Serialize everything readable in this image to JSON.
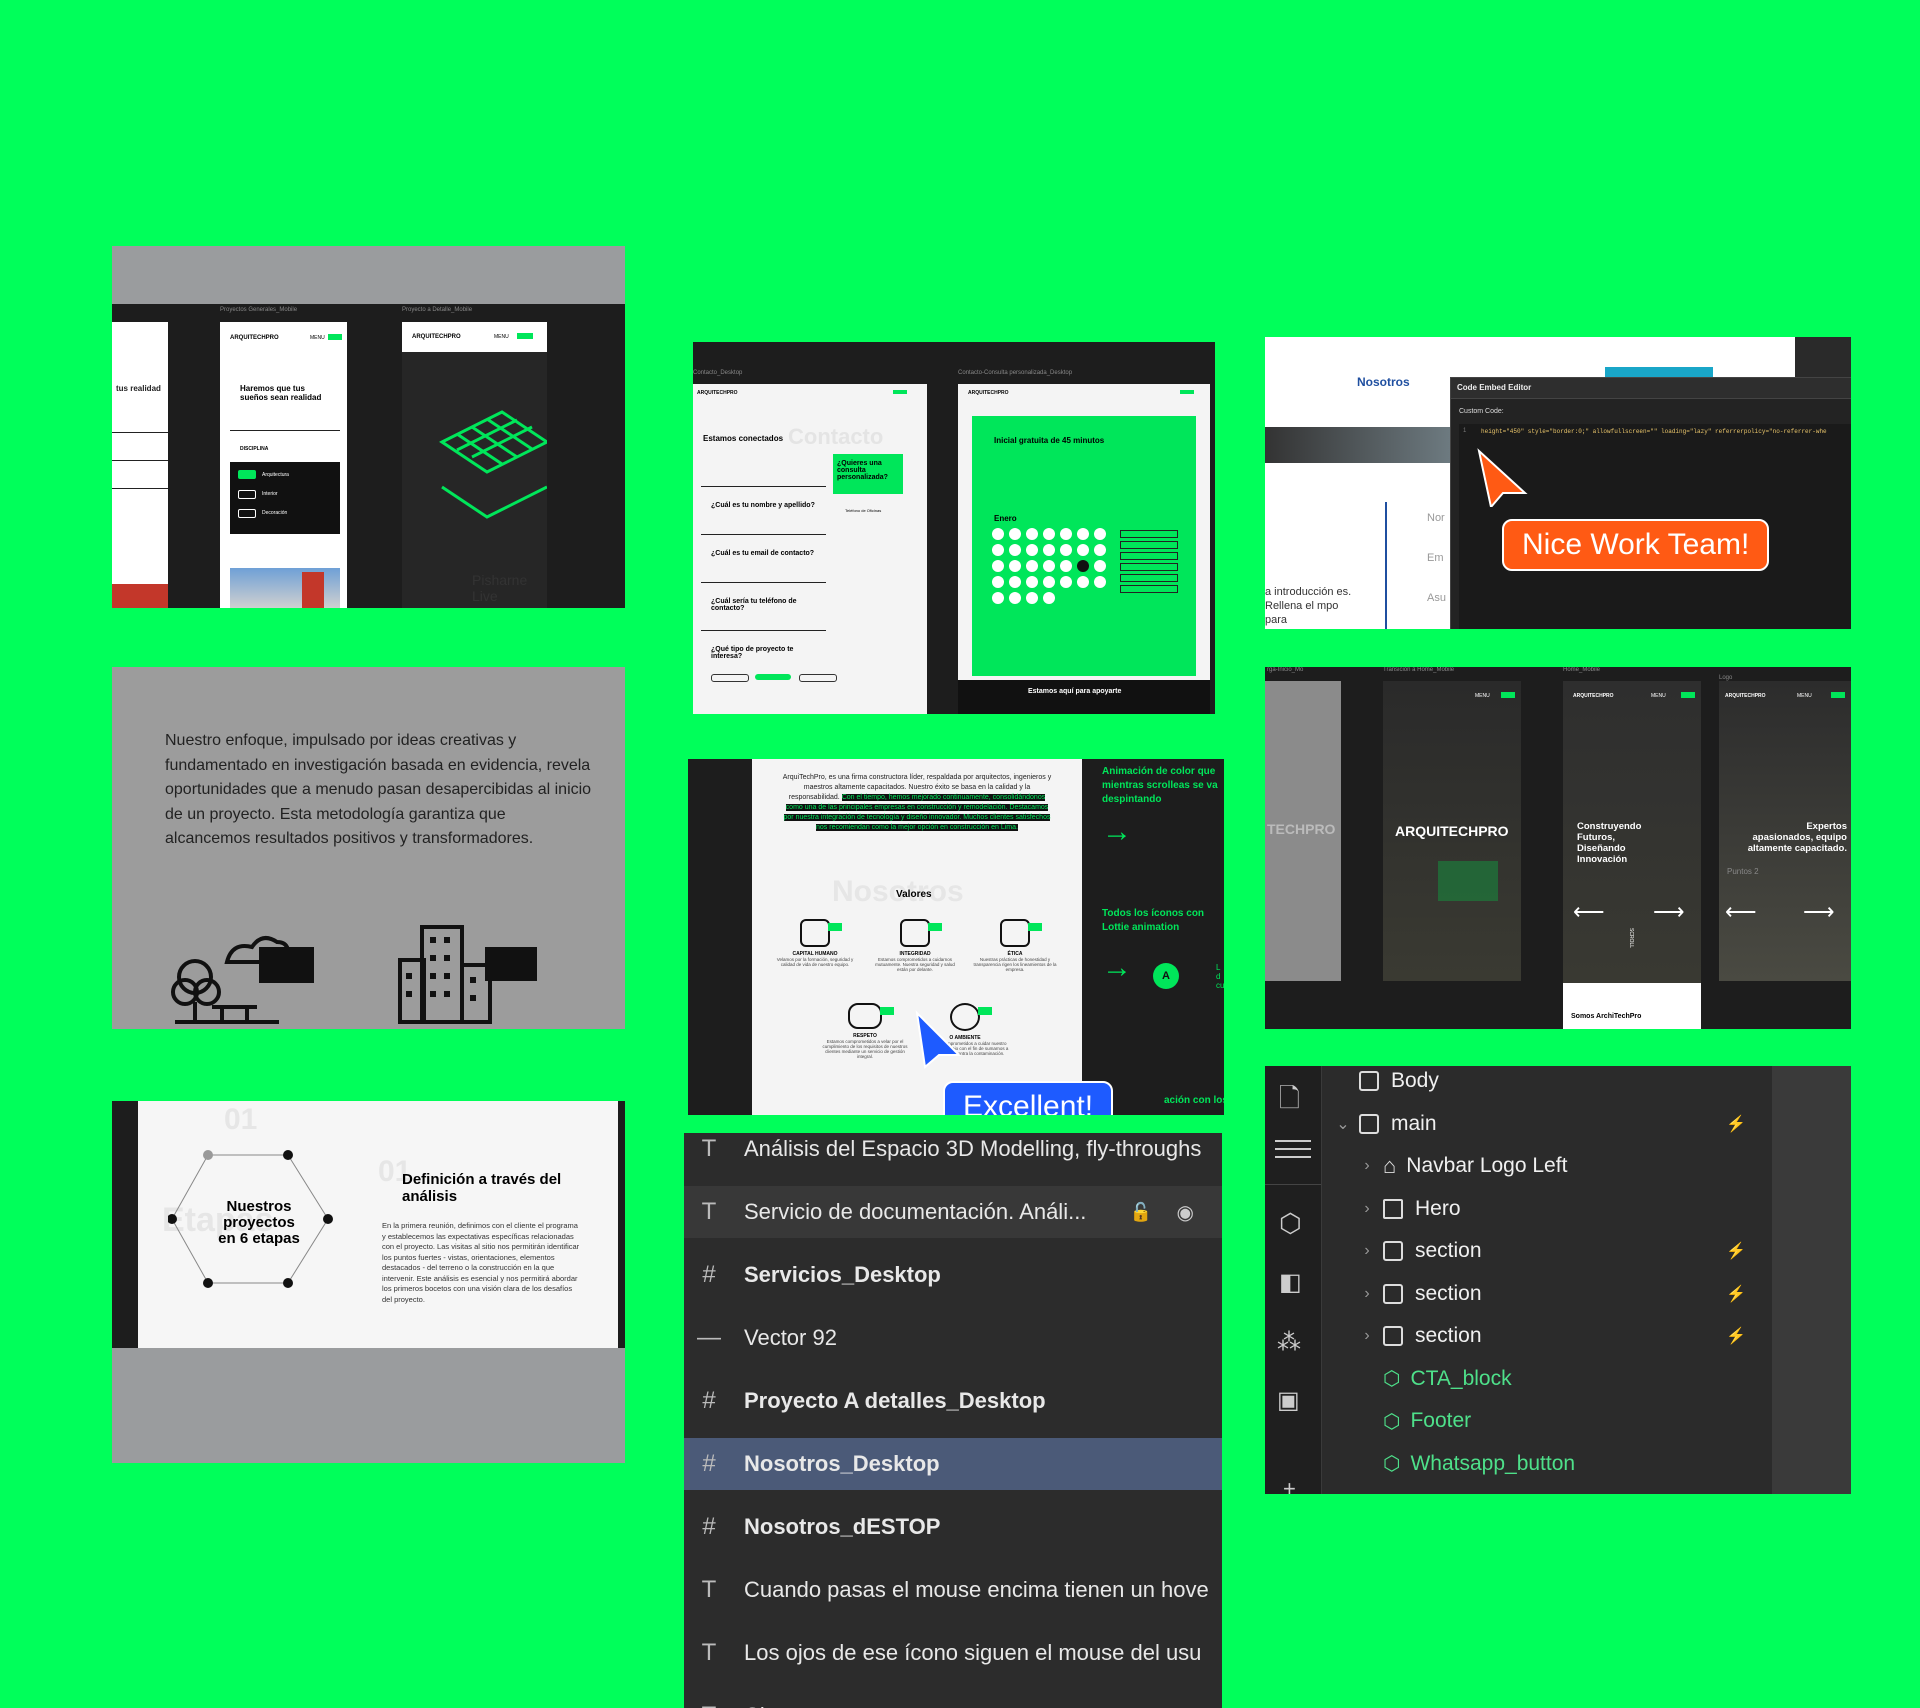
{
  "colors": {
    "background": "#00ff5a",
    "accent": "#00e65a",
    "cursor_orange": "#ff5a14",
    "cursor_blue": "#1e5bff"
  },
  "mobile": {
    "labels": [
      "Proyectos Generales_Mobile",
      "Proyecto a Detalle_Mobile"
    ],
    "menu": "MENU",
    "logo": "ARQUITECHPRO",
    "headline": "Haremos que tus sueños sean realidad",
    "headline_left": "tus realidad",
    "disciplina": "DISCIPLINA",
    "options": [
      "Arquitectura",
      "Interior",
      "Decoración"
    ],
    "bottom_text": "Pisharne Live"
  },
  "contact": {
    "labels": [
      "Contacto_Desktop",
      "Contacto-Consulta personalizada_Desktop"
    ],
    "title": "Estamos conectados",
    "bg_word": "Contacto",
    "q1": "¿Cuál es tu nombre y apellido?",
    "q2": "¿Cuál es tu email de contacto?",
    "q3": "¿Cuál sería tu teléfono de contacto?",
    "q4": "¿Qué tipo de proyecto te interesa?",
    "bubble": "¿Quieres una consulta personalizada?",
    "phone_label": "Teléfono de Oficinas",
    "consult_title": "Inicial gratuita de 45 minutos",
    "month": "Enero",
    "footer_text": "Estamos aquí para apoyarte"
  },
  "embed": {
    "nav_item": "Nosotros",
    "editor_title": "Code Embed Editor",
    "custom_code": "Custom Code:",
    "code_line": "height=\"450\" style=\"border:0;\" allowfullscreen=\"\" loading=\"lazy\" referrerpolicy=\"no-referrer-whe",
    "line_no": "1",
    "badge": "Nice Work Team!",
    "left_text": "a introducción es. Rellena el mpo para",
    "form_fields": [
      "Nor",
      "Em",
      "Asu"
    ]
  },
  "enfoque": {
    "paragraph": "Nuestro enfoque, impulsado por ideas creativas y fundamentado en investigación basada en evidencia, revela oportunidades que a menudo pasan desapercibidas al inicio de un proyecto. Esta metodología garantiza que alcancemos resultados positivos y transformadores."
  },
  "nosotros": {
    "intro_plain": "ArquiTechPro, es una firma constructora líder, respaldada por arquitectos, ingenieros y maestros altamente capacitados. Nuestro éxito se basa en la calidad y la responsabilidad.",
    "intro_highlight": "Con el tiempo, hemos mejorado continuamente, consolidándonos como una de las principales empresas en construcción y remodelación. Destacamos por nuestra integración de tecnología y diseño innovador. Muchos clientes satisfechos nos recomiendan como la mejor opción en construcción en Lima.",
    "bg_word": "Nosotros",
    "valores": "Valores",
    "values": [
      {
        "name": "CAPITAL HUMANO",
        "desc": "Velamos por la formación, seguridad y calidad de vida de nuestro equipo."
      },
      {
        "name": "INTEGRIDAD",
        "desc": "Estamos comprometidos a cuidarnos mutuamente. Nuestra seguridad y salud están por delante."
      },
      {
        "name": "ÉTICA",
        "desc": "Nuestras prácticas de honestidad y transparencia rigen los lineamientos de la empresa."
      },
      {
        "name": "RESPETO",
        "desc": "Estamos comprometidos a velar por el cumplimiento de los requisitos de nuestros clientes mediante un servicio de gestión integral."
      },
      {
        "name": "O AMBIENTE",
        "desc": "Estamos comprometidos a cuidar nuestro entorno de trabajo con el fin de sumarnos a la lucha global contra la contaminación."
      }
    ],
    "note1": "Animación de color que mientras scrolleas se va despintando",
    "note2": "Todos los íconos con Lottie animation",
    "note3": "ación con los",
    "note_side": "L d cu",
    "circle_letter": "A",
    "badge": "Excellent!"
  },
  "home_mobile": {
    "labels": [
      "rga-Inicio_Mo",
      "Transición a Home_Mobile",
      "Home_Mobile",
      "Logo"
    ],
    "logo": "ARQUITECHPRO",
    "logo_side": "TECHPRO",
    "tagline": "Construyendo Futuros, Diseñando Innovación",
    "tagline2": "Expertos apasionados, equipo altamente capacitado.",
    "puntos": "Puntos 2",
    "scroll": "SCROLL",
    "footer": "Somos ArchiTechPro",
    "menu": "MENU"
  },
  "stages": {
    "number": "01",
    "bg_word": "Etapas",
    "hex_text": "Nuestros proyectos en 6 etapas",
    "title": "Definición a través del análisis",
    "body": "En la primera reunión, definimos con el cliente el programa y establecemos las expectativas específicas relacionadas con el proyecto. Las visitas al sitio nos permitirán identificar los puntos fuertes - vistas, orientaciones, elementos destacados - del terreno o la construcción en la que intervenir. Este análisis es esencial y nos permitirá abordar los primeros bocetos con una visión clara de los desafíos del proyecto."
  },
  "layers": [
    {
      "icon": "text-icon",
      "label": "Análisis del Espacio 3D Modelling, fly-throughs",
      "bold": false
    },
    {
      "icon": "text-icon",
      "label": "Servicio de documentación. Análi...",
      "bold": false,
      "hovered": true
    },
    {
      "icon": "frame-icon",
      "label": "Servicios_Desktop",
      "bold": true
    },
    {
      "icon": "vector-icon",
      "label": "Vector 92",
      "bold": false
    },
    {
      "icon": "frame-icon",
      "label": "Proyecto A detalles_Desktop",
      "bold": true
    },
    {
      "icon": "frame-icon",
      "label": "Nosotros_Desktop",
      "bold": true,
      "selected": true
    },
    {
      "icon": "frame-icon",
      "label": "Nosotros_dESTOP",
      "bold": true
    },
    {
      "icon": "text-icon",
      "label": "Cuando pasas el mouse encima tienen un hove",
      "bold": false
    },
    {
      "icon": "text-icon",
      "label": "Los ojos de ese ícono siguen el mouse del usu",
      "bold": false
    },
    {
      "icon": "text-icon",
      "label": "Ci",
      "bold": false
    }
  ],
  "navigator": [
    {
      "label": "Body",
      "depth": 0,
      "kind": "body",
      "chev": false,
      "bolt": false
    },
    {
      "label": "main",
      "depth": 0,
      "kind": "box",
      "chev": true,
      "open": true,
      "bolt": true
    },
    {
      "label": "Navbar Logo Left",
      "depth": 1,
      "kind": "home",
      "chev": true,
      "bolt": false
    },
    {
      "label": "Hero",
      "depth": 1,
      "kind": "hero",
      "chev": true,
      "bolt": false
    },
    {
      "label": "section",
      "depth": 1,
      "kind": "box",
      "chev": true,
      "bolt": true
    },
    {
      "label": "section",
      "depth": 1,
      "kind": "box",
      "chev": true,
      "bolt": true
    },
    {
      "label": "section",
      "depth": 1,
      "kind": "box",
      "chev": true,
      "bolt": true
    },
    {
      "label": "CTA_block",
      "depth": 1,
      "kind": "comp",
      "chev": false,
      "bolt": false
    },
    {
      "label": "Footer",
      "depth": 1,
      "kind": "comp",
      "chev": false,
      "bolt": false
    },
    {
      "label": "Whatsapp_button",
      "depth": 1,
      "kind": "comp",
      "chev": false,
      "bolt": false
    }
  ]
}
